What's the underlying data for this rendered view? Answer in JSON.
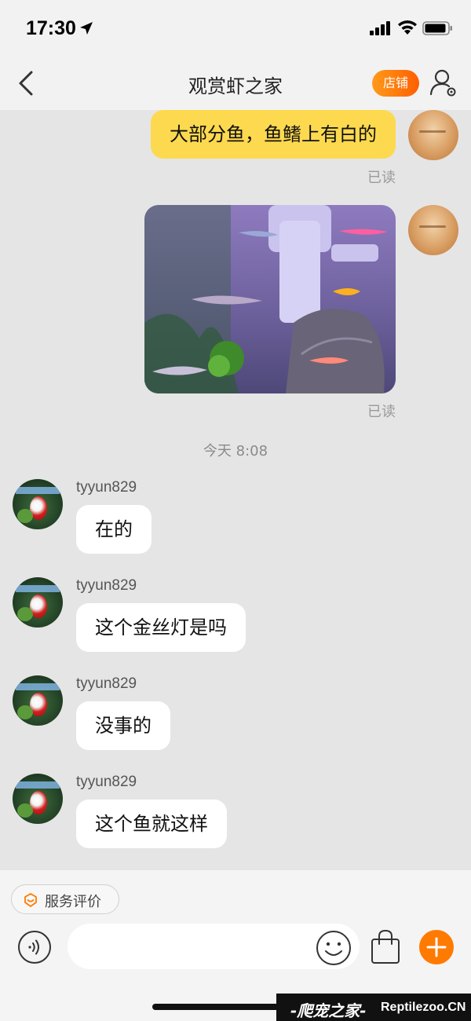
{
  "status_bar": {
    "time": "17:30",
    "icons": [
      "location-arrow-icon",
      "cellular-signal-icon",
      "wifi-icon",
      "battery-icon"
    ]
  },
  "nav": {
    "back_icon": "chevron-left-icon",
    "title": "观赏虾之家",
    "shop_label": "店铺",
    "profile_icon": "user-settings-icon",
    "accent_color": "#ff7a00"
  },
  "chat": {
    "outgoing": [
      {
        "text": "大部分鱼，鱼鳍上有白的",
        "status": "已读"
      },
      {
        "type": "image",
        "status": "已读"
      }
    ],
    "time_separator": "今天 8:08",
    "incoming": [
      {
        "sender": "tyyun829",
        "text": "在的"
      },
      {
        "sender": "tyyun829",
        "text": "这个金丝灯是吗"
      },
      {
        "sender": "tyyun829",
        "text": "没事的"
      },
      {
        "sender": "tyyun829",
        "text": "这个鱼就这样"
      }
    ],
    "outgoing_bubble_color": "#fdd94f"
  },
  "bottom": {
    "service_label": "服务评价",
    "input_value": "",
    "icons": [
      "voice-icon",
      "emoji-icon",
      "shopping-bag-icon",
      "plus-icon"
    ]
  },
  "watermark": {
    "cn": "-爬宠之家-",
    "en": "Reptilezoo.CN"
  }
}
